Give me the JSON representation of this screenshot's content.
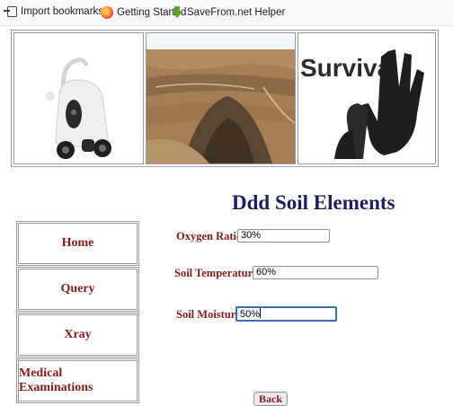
{
  "bookmarks": [
    {
      "label": "Import bookmarks...",
      "icon": "import-icon"
    },
    {
      "label": "Getting Started",
      "icon": "firefox-icon"
    },
    {
      "label": "SaveFrom.net Helper",
      "icon": "savefrom-icon"
    }
  ],
  "banner": {
    "image3_text": "Survival"
  },
  "page_title": "Ddd Soil Elements",
  "nav": [
    {
      "label": "Home"
    },
    {
      "label": "Query"
    },
    {
      "label": "Xray"
    },
    {
      "label": "Medical Examinations"
    }
  ],
  "form": {
    "oxygen_label": "Oxygen Ratio",
    "oxygen_value": "30%",
    "temperature_label": "Soil Temperature",
    "temperature_value": "60%",
    "moisture_label": "Soil Moisture",
    "moisture_value": "50%"
  },
  "back_label": "Back",
  "colors": {
    "title": "#1c1f5e",
    "label": "#8b1a1a",
    "focus": "#3d6fb4"
  }
}
